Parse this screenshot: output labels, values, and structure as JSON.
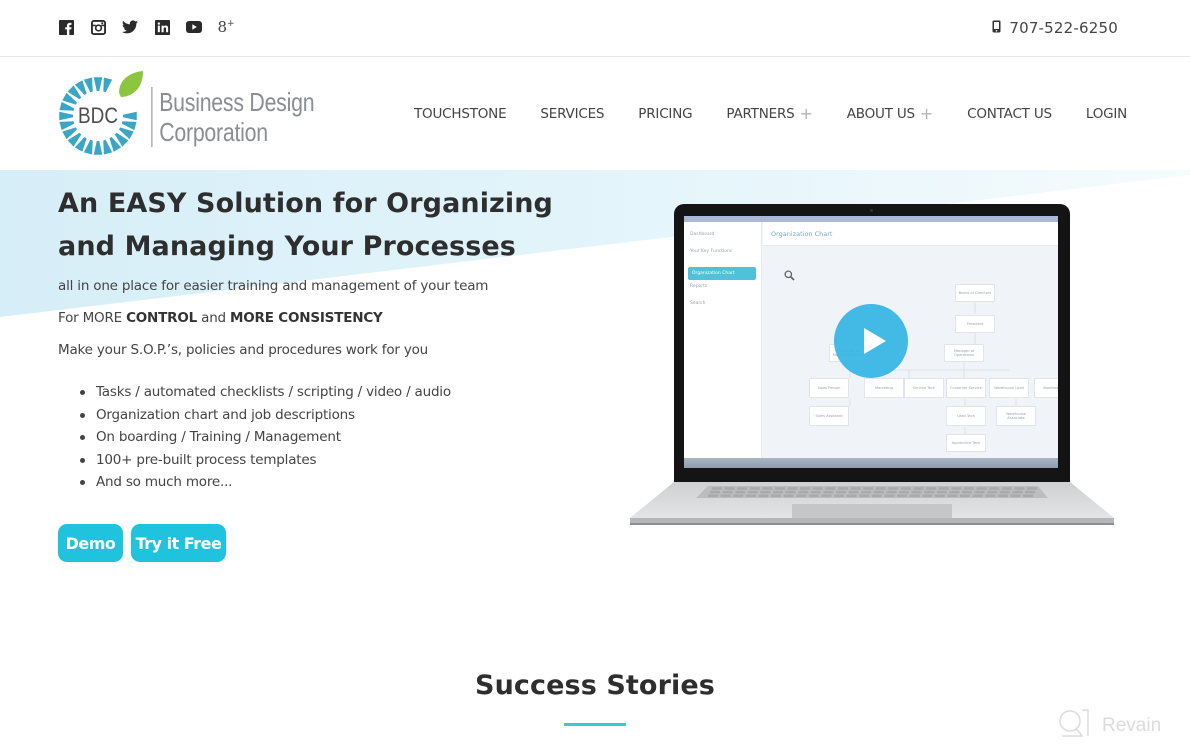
{
  "topbar": {
    "social": [
      {
        "name": "facebook-icon"
      },
      {
        "name": "instagram-icon"
      },
      {
        "name": "twitter-icon"
      },
      {
        "name": "linkedin-icon"
      },
      {
        "name": "youtube-icon"
      },
      {
        "name": "google-plus-icon"
      }
    ],
    "phone_icon": "mobile-phone-icon",
    "phone": "707-522-6250"
  },
  "header": {
    "logo": {
      "mark": "BDC",
      "line1": "Business Design",
      "line2": "Corporation"
    },
    "nav": [
      {
        "label": "TOUCHSTONE",
        "has_submenu": false
      },
      {
        "label": "SERVICES",
        "has_submenu": false
      },
      {
        "label": "PRICING",
        "has_submenu": false
      },
      {
        "label": "PARTNERS",
        "has_submenu": true
      },
      {
        "label": "ABOUT US",
        "has_submenu": true
      },
      {
        "label": "CONTACT US",
        "has_submenu": false
      },
      {
        "label": "LOGIN",
        "has_submenu": false
      }
    ],
    "submenu_glyph": "+"
  },
  "hero": {
    "title_line1": "An EASY Solution for Organizing",
    "title_line2": "and Managing Your Processes",
    "subtitle": "all in one place for easier training and management of your team",
    "control_prefix": "For MORE ",
    "control_bold1": "CONTROL",
    "control_mid": " and ",
    "control_bold2": "MORE CONSISTENCY",
    "sop_line": "Make your S.O.P.’s, policies and procedures work for you",
    "bullets": [
      "Tasks / automated checklists / scripting / video / audio",
      "Organization chart and job descriptions",
      "On boarding / Training / Management",
      "100+ pre-built process templates",
      "And so much more..."
    ],
    "buttons": {
      "demo": "Demo",
      "try_free": "Try it Free"
    }
  },
  "video": {
    "app_sidebar": [
      "Dashboard",
      "Your Key Functions",
      "Organization Chart",
      "Reports",
      "Search"
    ],
    "app_active_item": "Organization Chart",
    "app_title": "Organization Chart",
    "org_chart": [
      "Board of Directors",
      "President",
      "Manager of Operations",
      "Manager of Marketing & Sales",
      "Sales Person",
      "Marketing",
      "Service Tech",
      "Customer Service",
      "Warehouse Lead",
      "Bookkeeper",
      "Sales Assistant",
      "Lead Tech",
      "Warehouse Associate",
      "Apprentice Tech"
    ],
    "play_icon": "play-icon"
  },
  "success": {
    "title": "Success Stories"
  },
  "watermark": {
    "text": "Revain"
  },
  "colors": {
    "accent": "#1fc3de",
    "logo_blue": "#3aa6c6",
    "logo_green": "#8cc63f",
    "text_dark": "#2e2e2e",
    "hero_bg": "#dff3fa"
  }
}
